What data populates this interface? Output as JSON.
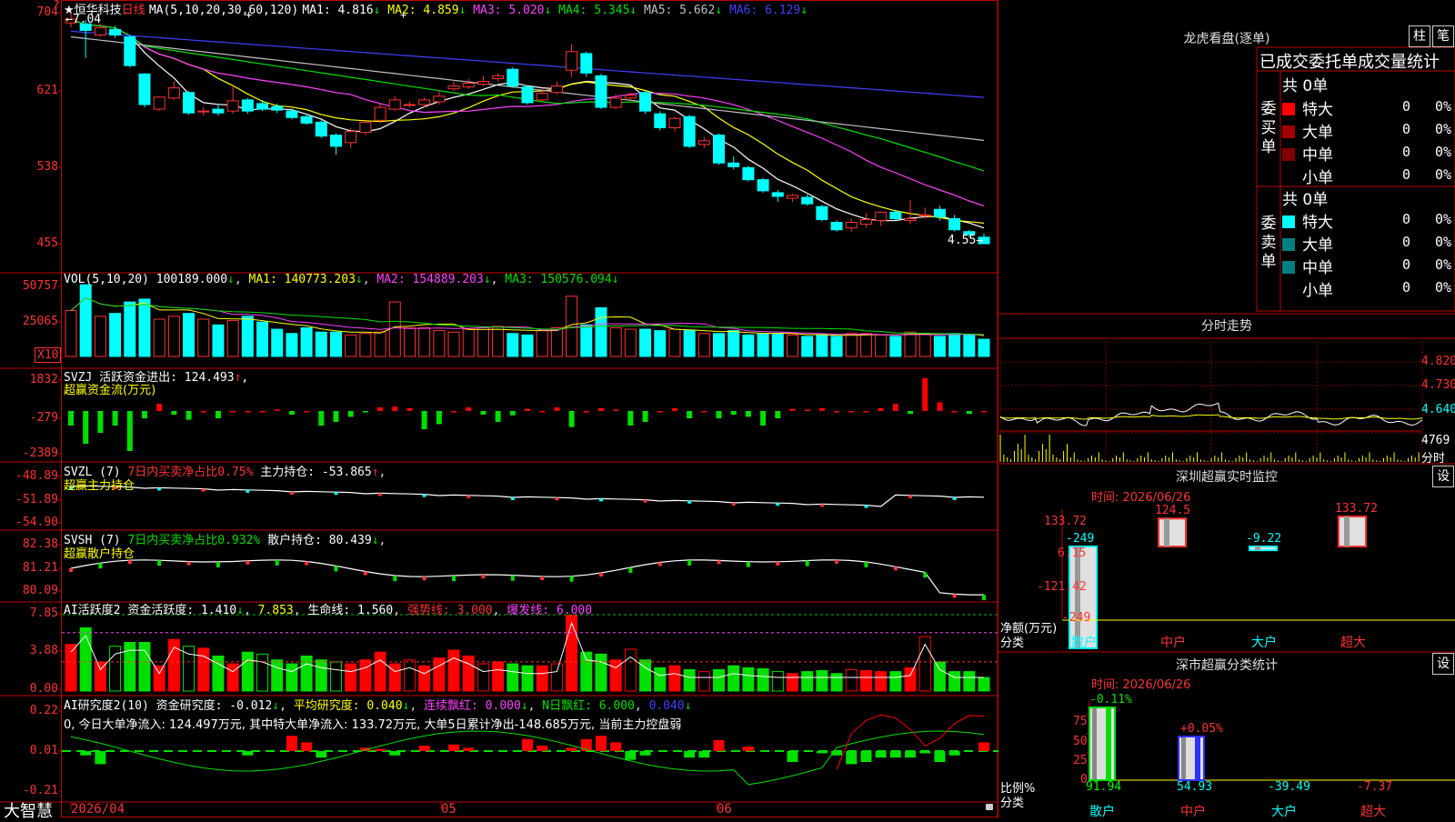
{
  "stock": {
    "star": "★",
    "name": "恒华科技",
    "period": "日线"
  },
  "k_header": {
    "ma_params": "MA(5,10,20,30,60,120)",
    "ma": [
      {
        "label": "MA1:",
        "value": "4.816",
        "arrow": "↓",
        "color": "#ffffff"
      },
      {
        "label": "MA2:",
        "value": "4.859",
        "arrow": "↓",
        "color": "#ffff00"
      },
      {
        "label": "MA3:",
        "value": "5.020",
        "arrow": "↓",
        "color": "#ff40ff"
      },
      {
        "label": "MA4:",
        "value": "5.345",
        "arrow": "↓",
        "color": "#00e000"
      },
      {
        "label": "MA5:",
        "value": "5.662",
        "arrow": "↓",
        "color": "#c0c0c0"
      },
      {
        "label": "MA6:",
        "value": "6.129",
        "arrow": "↓",
        "color": "#4040ff"
      }
    ],
    "high_mark": "7.04",
    "low_mark": "4.55"
  },
  "k_axis": [
    "704",
    "621",
    "538",
    "455"
  ],
  "k_question": "?",
  "vol_header": {
    "params": "VOL(5,10,20)",
    "value": "100189.000",
    "arrow": "↓",
    "ma1": "MA1: 140773.203",
    "ma2": "MA2: 154889.203",
    "ma3": "MA3: 150576.094"
  },
  "vol_axis": [
    "50757",
    "25065"
  ],
  "vol_unit": "X10",
  "svzj": {
    "line1": "SVZJ  活跃资金进出: 124.493",
    "line2": "超赢资金流(万元)",
    "axis": [
      "1832",
      "-279",
      "-2389"
    ]
  },
  "svzl": {
    "name": "SVZL (7)",
    "ratio": "7日内买卖净占比0.75%",
    "hold": "主力持仓: -53.865",
    "line2": "超赢主力持仓",
    "axis": [
      "-48.89",
      "-51.89",
      "-54.90"
    ]
  },
  "svsh": {
    "name": "SVSH (7)",
    "ratio": "7日内买卖净占比0.932%",
    "hold": "散户持仓: 80.439",
    "line2": "超赢散户持仓",
    "axis": [
      "82.38",
      "81.21",
      "80.09"
    ]
  },
  "ai1": {
    "name": "AI活跃度2",
    "act": "资金活跃度: 1.410",
    "v2": "7.853",
    "life": "生命线: 1.560",
    "strong": "强势线: 3.000",
    "burst": "爆发线: 6.000",
    "axis": [
      "7.85",
      "3.88",
      "0.00"
    ]
  },
  "ai2": {
    "name": "AI研究度2(10)",
    "res": "资金研究度: -0.012",
    "avg": "平均研究度: 0.040",
    "cont": "连续飘红: 0.000",
    "nday": "N日飘红: 6.000",
    "v5": "0.040",
    "desc": "0, 今日大单净流入: 124.497万元, 其中特大单净流入: 133.72万元, 大单5日累计净出-148.685万元, 当前主力控盘弱",
    "axis": [
      "0.22",
      "0.01",
      "-0.21"
    ]
  },
  "x_axis": {
    "start": "2026/04",
    "m5": "05",
    "m6": "06"
  },
  "brand": "大智慧",
  "lhb": {
    "title": "龙虎看盘(逐单)",
    "btn1": "柱",
    "btn2": "笔",
    "tab": "已成交委托单成交量统计",
    "buy_label": "委买单",
    "sell_label": "委卖单",
    "buy_total": "共 0单",
    "sell_total": "共 0单",
    "buy": [
      {
        "name": "特大",
        "v": "0",
        "p": "0%",
        "color": "#ff0000"
      },
      {
        "name": "大单",
        "v": "0",
        "p": "0%",
        "color": "#a00000"
      },
      {
        "name": "中单",
        "v": "0",
        "p": "0%",
        "color": "#800000"
      },
      {
        "name": "小单",
        "v": "0",
        "p": "0%",
        "color": "#000000"
      }
    ],
    "sell": [
      {
        "name": "特大",
        "v": "0",
        "p": "0%",
        "color": "#00ffff"
      },
      {
        "name": "大单",
        "v": "0",
        "p": "0%",
        "color": "#008080"
      },
      {
        "name": "中单",
        "v": "0",
        "p": "0%",
        "color": "#008080"
      },
      {
        "name": "小单",
        "v": "0",
        "p": "0%",
        "color": "#000000"
      }
    ]
  },
  "intraday": {
    "title": "分时走势",
    "axis": [
      "4.820",
      "4.730",
      "4.640"
    ],
    "vol": "4769",
    "vol_label": "分时"
  },
  "sz_monitor": {
    "title": "深圳超赢实时监控",
    "btn": "设",
    "time": "时间: 2026/06/26",
    "axis": [
      "133.72",
      "6.15",
      "-121.42",
      "-249"
    ],
    "unit": "净额(万元)",
    "cat": "分类",
    "bars": [
      {
        "label": "散户",
        "value": "-249",
        "v": -249
      },
      {
        "label": "中户",
        "value": "124.5",
        "v": 124.5
      },
      {
        "label": "大户",
        "value": "-9.22",
        "v": -9.22
      },
      {
        "label": "超大",
        "value": "133.72",
        "v": 133.72
      }
    ]
  },
  "sz_stats": {
    "title": "深市超赢分类统计",
    "btn": "设",
    "time": "时间: 2026/06/26",
    "axis": [
      "75",
      "50",
      "25",
      "0"
    ],
    "unit": "比例%",
    "cat": "分类",
    "top": [
      "-0.11%",
      "+0.05%"
    ],
    "bottom": [
      {
        "label": "散户",
        "value": "91.94"
      },
      {
        "label": "中户",
        "value": "54.93"
      },
      {
        "label": "大户",
        "value": "-39.49"
      },
      {
        "label": "超大",
        "value": "-7.37"
      }
    ]
  },
  "chart_data": {
    "type": "candlestick",
    "candles": [
      [
        6.93,
        6.97,
        6.88,
        7.04
      ],
      [
        6.92,
        6.85,
        6.55,
        6.96
      ],
      [
        6.8,
        6.88,
        6.78,
        6.92
      ],
      [
        6.86,
        6.8,
        6.77,
        6.9
      ],
      [
        6.78,
        6.47,
        6.45,
        6.8
      ],
      [
        6.38,
        6.05,
        6.02,
        6.39
      ],
      [
        6.0,
        6.13,
        5.98,
        6.14
      ],
      [
        6.12,
        6.23,
        6.1,
        6.3
      ],
      [
        6.18,
        5.96,
        5.94,
        6.2
      ],
      [
        5.98,
        5.98,
        5.93,
        6.02
      ],
      [
        6.0,
        5.96,
        5.93,
        6.05
      ],
      [
        5.98,
        6.09,
        5.95,
        6.25
      ],
      [
        6.1,
        5.98,
        5.95,
        6.12
      ],
      [
        6.06,
        6.0,
        5.98,
        6.1
      ],
      [
        6.03,
        5.99,
        5.96,
        6.06
      ],
      [
        5.98,
        5.91,
        5.89,
        6.01
      ],
      [
        5.92,
        5.85,
        5.83,
        5.95
      ],
      [
        5.86,
        5.71,
        5.69,
        5.88
      ],
      [
        5.72,
        5.6,
        5.51,
        5.74
      ],
      [
        5.64,
        5.76,
        5.58,
        5.8
      ],
      [
        5.75,
        5.86,
        5.72,
        5.87
      ],
      [
        5.88,
        6.02,
        5.85,
        6.06
      ],
      [
        6.0,
        6.1,
        5.98,
        6.14
      ],
      [
        6.05,
        6.05,
        6.02,
        6.08
      ],
      [
        6.05,
        6.1,
        6.02,
        6.13
      ],
      [
        6.08,
        6.14,
        6.05,
        6.2
      ],
      [
        6.22,
        6.25,
        6.2,
        6.3
      ],
      [
        6.24,
        6.28,
        6.22,
        6.33
      ],
      [
        6.27,
        6.3,
        6.25,
        6.36
      ],
      [
        6.33,
        6.36,
        6.3,
        6.39
      ],
      [
        6.43,
        6.25,
        6.23,
        6.45
      ],
      [
        6.24,
        6.07,
        6.05,
        6.26
      ],
      [
        6.1,
        6.17,
        6.08,
        6.22
      ],
      [
        6.18,
        6.25,
        6.16,
        6.3
      ],
      [
        6.42,
        6.62,
        6.35,
        6.7
      ],
      [
        6.6,
        6.39,
        6.35,
        6.62
      ],
      [
        6.36,
        6.02,
        6.0,
        6.38
      ],
      [
        6.02,
        6.12,
        6.0,
        6.16
      ],
      [
        6.12,
        6.15,
        6.08,
        6.18
      ],
      [
        6.18,
        5.98,
        5.95,
        6.2
      ],
      [
        5.95,
        5.8,
        5.77,
        5.98
      ],
      [
        5.8,
        5.9,
        5.76,
        5.92
      ],
      [
        5.92,
        5.6,
        5.58,
        5.94
      ],
      [
        5.62,
        5.66,
        5.58,
        5.7
      ],
      [
        5.72,
        5.42,
        5.4,
        5.74
      ],
      [
        5.42,
        5.38,
        5.35,
        5.49
      ],
      [
        5.37,
        5.24,
        5.22,
        5.39
      ],
      [
        5.24,
        5.12,
        5.1,
        5.26
      ],
      [
        5.1,
        5.06,
        5.0,
        5.13
      ],
      [
        5.04,
        5.07,
        5.0,
        5.09
      ],
      [
        5.05,
        4.98,
        4.96,
        5.08
      ],
      [
        4.95,
        4.81,
        4.79,
        4.97
      ],
      [
        4.78,
        4.7,
        4.68,
        4.8
      ],
      [
        4.72,
        4.78,
        4.68,
        4.82
      ],
      [
        4.76,
        4.81,
        4.72,
        4.88
      ],
      [
        4.8,
        4.89,
        4.74,
        4.9
      ],
      [
        4.89,
        4.82,
        4.8,
        4.92
      ],
      [
        4.8,
        4.82,
        4.76,
        5.02
      ],
      [
        4.86,
        4.86,
        4.82,
        4.94
      ],
      [
        4.92,
        4.84,
        4.8,
        4.96
      ],
      [
        4.82,
        4.7,
        4.68,
        4.86
      ],
      [
        4.68,
        4.65,
        4.62,
        4.7
      ],
      [
        4.62,
        4.55,
        4.55,
        4.66
      ]
    ],
    "volume": [
      32000,
      50000,
      28000,
      30000,
      38000,
      40000,
      26000,
      28000,
      30000,
      26000,
      22000,
      25000,
      28000,
      24000,
      19000,
      16000,
      20000,
      17000,
      17000,
      15000,
      16000,
      17000,
      38000,
      20000,
      20000,
      18000,
      17000,
      19000,
      20000,
      21000,
      16000,
      15000,
      18000,
      20000,
      42000,
      22000,
      34000,
      20000,
      19000,
      19000,
      18000,
      19000,
      18000,
      16000,
      16000,
      18000,
      15000,
      16000,
      16000,
      15000,
      14000,
      15000,
      14000,
      16000,
      16000,
      15000,
      14000,
      17000,
      16000,
      14000,
      16000,
      15000,
      12000,
      10000
    ],
    "ma_colors": [
      "#ffffff",
      "#ffff00",
      "#ff40ff",
      "#00e000",
      "#c0c0c0",
      "#4040ff"
    ]
  }
}
